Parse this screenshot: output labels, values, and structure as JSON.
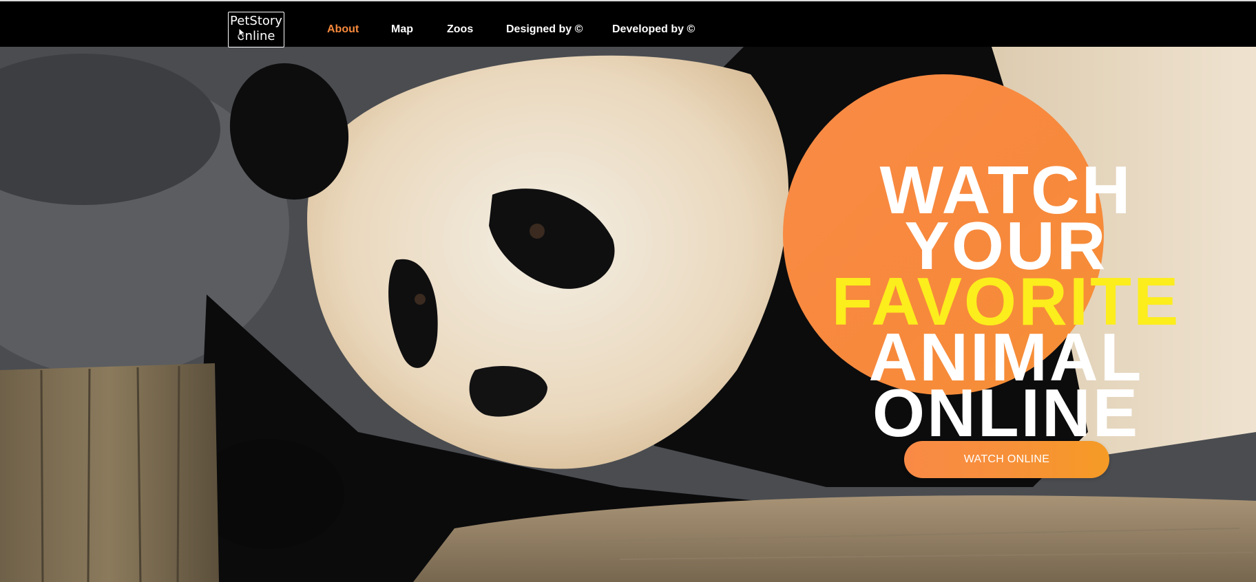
{
  "brand": {
    "logo_line1": "PetStory",
    "logo_line2": "online"
  },
  "nav": {
    "items": [
      {
        "label": "About",
        "active": true
      },
      {
        "label": "Map"
      },
      {
        "label": "Zoos"
      },
      {
        "label": "Designed by ©"
      },
      {
        "label": "Developed by ©"
      }
    ]
  },
  "hero": {
    "headline": {
      "line1": "WATCH",
      "line2": "YOUR",
      "line3": "FAVORITE",
      "line4": "ANIMAL",
      "line5": "ONLINE"
    },
    "cta_label": "WATCH ONLINE",
    "image_subject": "giant panda resting on wooden log"
  },
  "colors": {
    "accent_orange": "#f7893c",
    "highlight_yellow": "#fced1d",
    "nav_background": "#000000",
    "text_white": "#ffffff"
  }
}
